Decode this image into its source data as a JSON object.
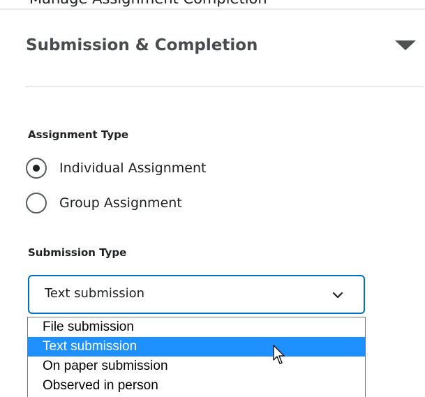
{
  "previous_section": {
    "title": "Manage Assignment Completion"
  },
  "section": {
    "title": "Submission & Completion",
    "toggle_icon": "caret-down-icon"
  },
  "assignment_type": {
    "label": "Assignment Type",
    "options": [
      {
        "label": "Individual Assignment",
        "selected": true
      },
      {
        "label": "Group Assignment",
        "selected": false
      }
    ]
  },
  "submission_type": {
    "label": "Submission Type",
    "selected_value": "Text submission",
    "chevron_icon": "chevron-down-icon",
    "dropdown_open": true,
    "options": [
      {
        "label": "File submission",
        "highlighted": false
      },
      {
        "label": "Text submission",
        "highlighted": true
      },
      {
        "label": "On paper submission",
        "highlighted": false
      },
      {
        "label": "Observed in person",
        "highlighted": false
      }
    ]
  },
  "colors": {
    "focus_border": "#006fbf",
    "option_highlight": "#1e90ff",
    "heading_text": "#494c4e",
    "body_text": "#202122"
  },
  "cursor_icon": "mouse-pointer-icon"
}
